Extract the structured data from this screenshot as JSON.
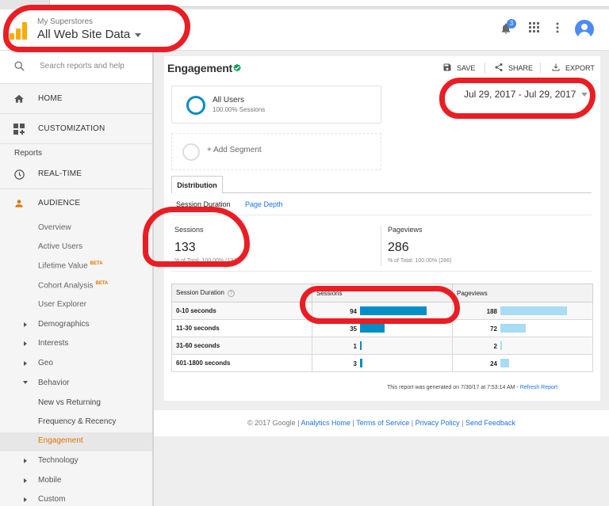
{
  "header": {
    "account_name": "My Superstores",
    "view_name": "All Web Site Data",
    "notification_count": "3"
  },
  "sidebar": {
    "search_placeholder": "Search reports and help",
    "home": "HOME",
    "customization": "CUSTOMIZATION",
    "reports_heading": "Reports",
    "realtime": "REAL-TIME",
    "audience": "AUDIENCE",
    "audience_items": [
      {
        "label": "Overview",
        "badge": ""
      },
      {
        "label": "Active Users",
        "badge": ""
      },
      {
        "label": "Lifetime Value",
        "badge": "BETA"
      },
      {
        "label": "Cohort Analysis",
        "badge": "BETA"
      },
      {
        "label": "User Explorer",
        "badge": ""
      }
    ],
    "groups": [
      "Demographics",
      "Interests",
      "Geo"
    ],
    "behavior": "Behavior",
    "behavior_items": [
      "New vs Returning",
      "Frequency & Recency",
      "Engagement"
    ],
    "groups_after": [
      "Technology",
      "Mobile",
      "Custom"
    ]
  },
  "report": {
    "title": "Engagement",
    "actions": {
      "save": "SAVE",
      "share": "SHARE",
      "export": "EXPORT"
    },
    "date_range": "Jul 29, 2017 - Jul 29, 2017",
    "segment": {
      "name": "All Users",
      "sub": "100.00% Sessions"
    },
    "add_segment": "+ Add Segment",
    "tab": "Distribution",
    "subtabs": {
      "active": "Session Duration",
      "other": "Page Depth"
    },
    "metrics": {
      "sessions": {
        "label": "Sessions",
        "value": "133",
        "sub": "% of Total: 100.00% (133)"
      },
      "pageviews": {
        "label": "Pageviews",
        "value": "286",
        "sub": "% of Total: 100.00% (286)"
      }
    },
    "table": {
      "headers": [
        "Session Duration",
        "Sessions",
        "Pageviews"
      ],
      "help_glyph": "?",
      "rows": [
        {
          "duration": "0-10 seconds",
          "sessions": "94",
          "pageviews": "188",
          "sessions_frac": 1.0,
          "pageviews_frac": 1.0
        },
        {
          "duration": "11-30 seconds",
          "sessions": "35",
          "pageviews": "72",
          "sessions_frac": 0.372,
          "pageviews_frac": 0.383
        },
        {
          "duration": "31-60 seconds",
          "sessions": "1",
          "pageviews": "2",
          "sessions_frac": 0.02,
          "pageviews_frac": 0.02
        },
        {
          "duration": "601-1800 seconds",
          "sessions": "3",
          "pageviews": "24",
          "sessions_frac": 0.04,
          "pageviews_frac": 0.13
        }
      ]
    },
    "generated_note": "This report was generated on 7/30/17 at 7:53:14 AM - ",
    "refresh_link": "Refresh Report"
  },
  "footer": {
    "copyright": "© 2017 Google | ",
    "links": [
      "Analytics Home",
      "Terms of Service",
      "Privacy Policy",
      "Send Feedback"
    ]
  },
  "colors": {
    "sessions_bar": "#058dc7",
    "pageviews_bar": "#a8dcf5",
    "accent_orange": "#e37400",
    "annotation_red": "#ea1d24"
  }
}
